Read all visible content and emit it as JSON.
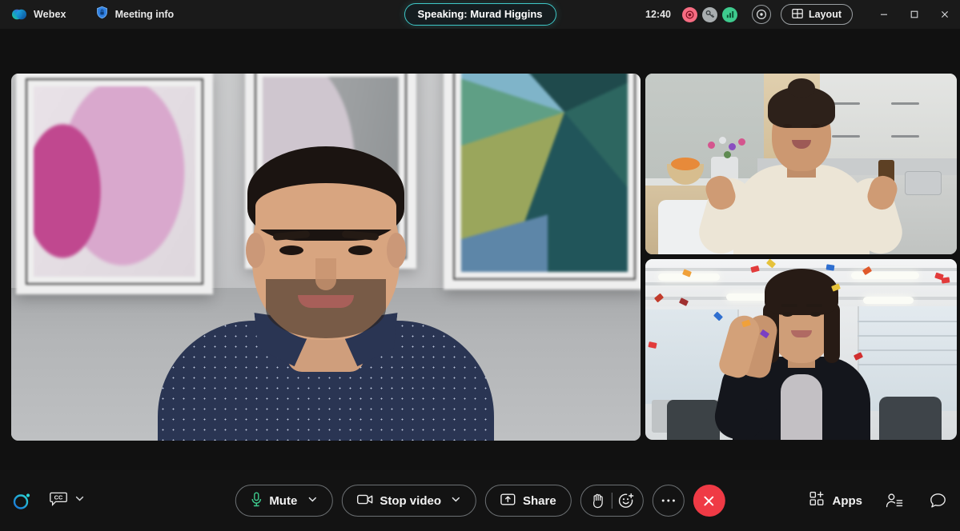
{
  "titlebar": {
    "brand": "Webex",
    "brand_icon": "webex-logo-icon",
    "meeting_info": "Meeting info",
    "meeting_info_icon": "shield-lock-icon",
    "speaking_banner": "Speaking: Murad Higgins",
    "clock": "12:40",
    "status_icons": [
      {
        "name": "recording-indicator-icon",
        "color": "#f76c82"
      },
      {
        "name": "meeting-key-icon",
        "color": "#a9aeb0"
      },
      {
        "name": "network-signal-icon",
        "color": "#3ecb8e"
      }
    ],
    "camera_view_icon": "camera-view-icon",
    "layout_label": "Layout",
    "layout_icon": "grid-layout-icon",
    "window_minimize_icon": "minimize-icon",
    "window_maximize_icon": "maximize-icon",
    "window_close_icon": "close-icon",
    "accent_speaking": "#3ec7c7"
  },
  "stage": {
    "main_tile": {
      "name": "Murad Higgins",
      "scene": "man in navy polka-dot shirt in front of grey wall with framed abstract art"
    },
    "side_tiles": [
      {
        "scene": "woman gesturing in a kitchen with wooden cabinets"
      },
      {
        "scene": "woman clapping in an open office with confetti"
      }
    ]
  },
  "bottombar": {
    "ai_assistant_icon": "webex-ai-assistant-icon",
    "captions_icon": "closed-captions-icon",
    "captions_chevron_icon": "chevron-down-icon",
    "mute_label": "Mute",
    "mute_icon": "microphone-icon",
    "mute_icon_color": "#3ecb8e",
    "mute_chevron_icon": "chevron-down-icon",
    "video_label": "Stop video",
    "video_icon": "camera-icon",
    "video_chevron_icon": "chevron-down-icon",
    "share_label": "Share",
    "share_icon": "share-screen-icon",
    "raise_hand_icon": "raise-hand-icon",
    "reactions_icon": "reactions-smiley-icon",
    "more_icon": "more-options-icon",
    "end_call_icon": "end-call-icon",
    "end_call_color": "#ef3a45",
    "apps_label": "Apps",
    "apps_icon": "apps-grid-icon",
    "participants_icon": "participants-icon",
    "chat_icon": "chat-bubble-icon"
  }
}
